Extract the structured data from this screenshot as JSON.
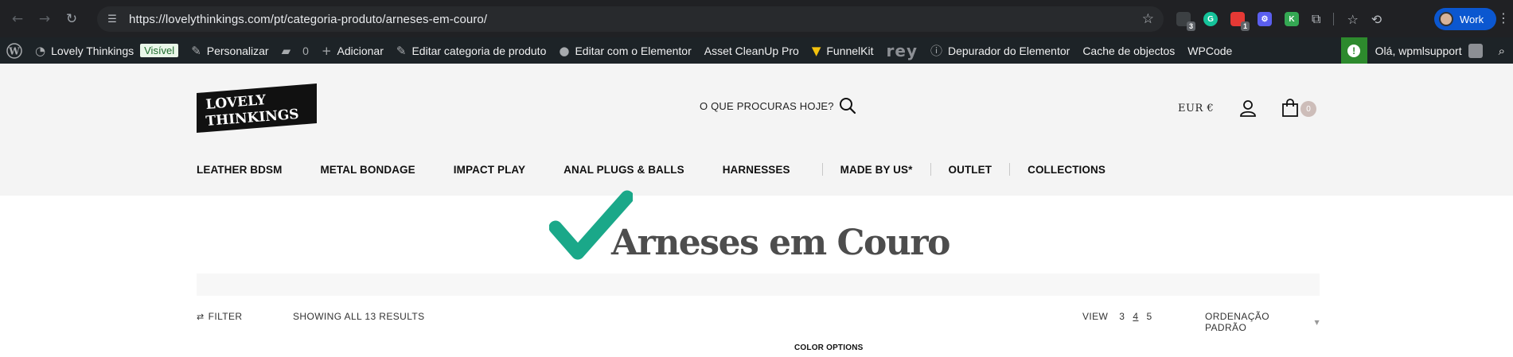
{
  "browser": {
    "url": "https://lovelythinkings.com/pt/categoria-produto/arneses-em-couro/",
    "profile_name": "Work",
    "extensions": [
      {
        "name": "tab-manager",
        "badge": "3",
        "color": "#5f6368"
      },
      {
        "name": "grammarly",
        "badge": "",
        "color": "#15c39a"
      },
      {
        "name": "red-extension",
        "badge": "1",
        "color": "#e53935"
      },
      {
        "name": "purple-extension",
        "badge": "",
        "color": "#5b5fef"
      },
      {
        "name": "k-extension",
        "badge": "",
        "color": "#34a853"
      }
    ]
  },
  "admin_bar": {
    "site_name": "Lovely Thinkings",
    "visible_badge": "Visível",
    "customize": "Personalizar",
    "comments_count": "0",
    "add_new": "Adicionar",
    "edit_category": "Editar categoria de produto",
    "edit_elementor": "Editar com o Elementor",
    "asset_cleanup": "Asset CleanUp Pro",
    "funnelkit": "FunnelKit",
    "rey": "rey",
    "elementor_debugger": "Depurador do Elementor",
    "object_cache": "Cache de objectos",
    "wpcode": "WPCode",
    "greeting": "Olá, wpmlsupport"
  },
  "header": {
    "logo_line1": "LOVELY",
    "logo_line2": "THINKINGS",
    "search_label": "O QUE PROCURAS HOJE?",
    "currency": "EUR €",
    "cart_count": "0",
    "menu": [
      {
        "label": "LEATHER BDSM"
      },
      {
        "label": "METAL BONDAGE"
      },
      {
        "label": "IMPACT PLAY"
      },
      {
        "label": "ANAL PLUGS & BALLS"
      },
      {
        "label": "HARNESSES"
      },
      {
        "label": "MADE BY US*"
      },
      {
        "label": "OUTLET"
      },
      {
        "label": "COLLECTIONS"
      }
    ]
  },
  "page": {
    "title": "Arneses em Couro",
    "filter_label": "FILTER",
    "results_label": "SHOWING ALL 13 RESULTS",
    "view_label": "VIEW",
    "view_options": [
      "3",
      "4",
      "5"
    ],
    "view_active": "4",
    "sort_label": "ORDENAÇÃO PADRÃO",
    "color_options": "COLOR OPTIONS",
    "check_color": "#1aa889"
  }
}
